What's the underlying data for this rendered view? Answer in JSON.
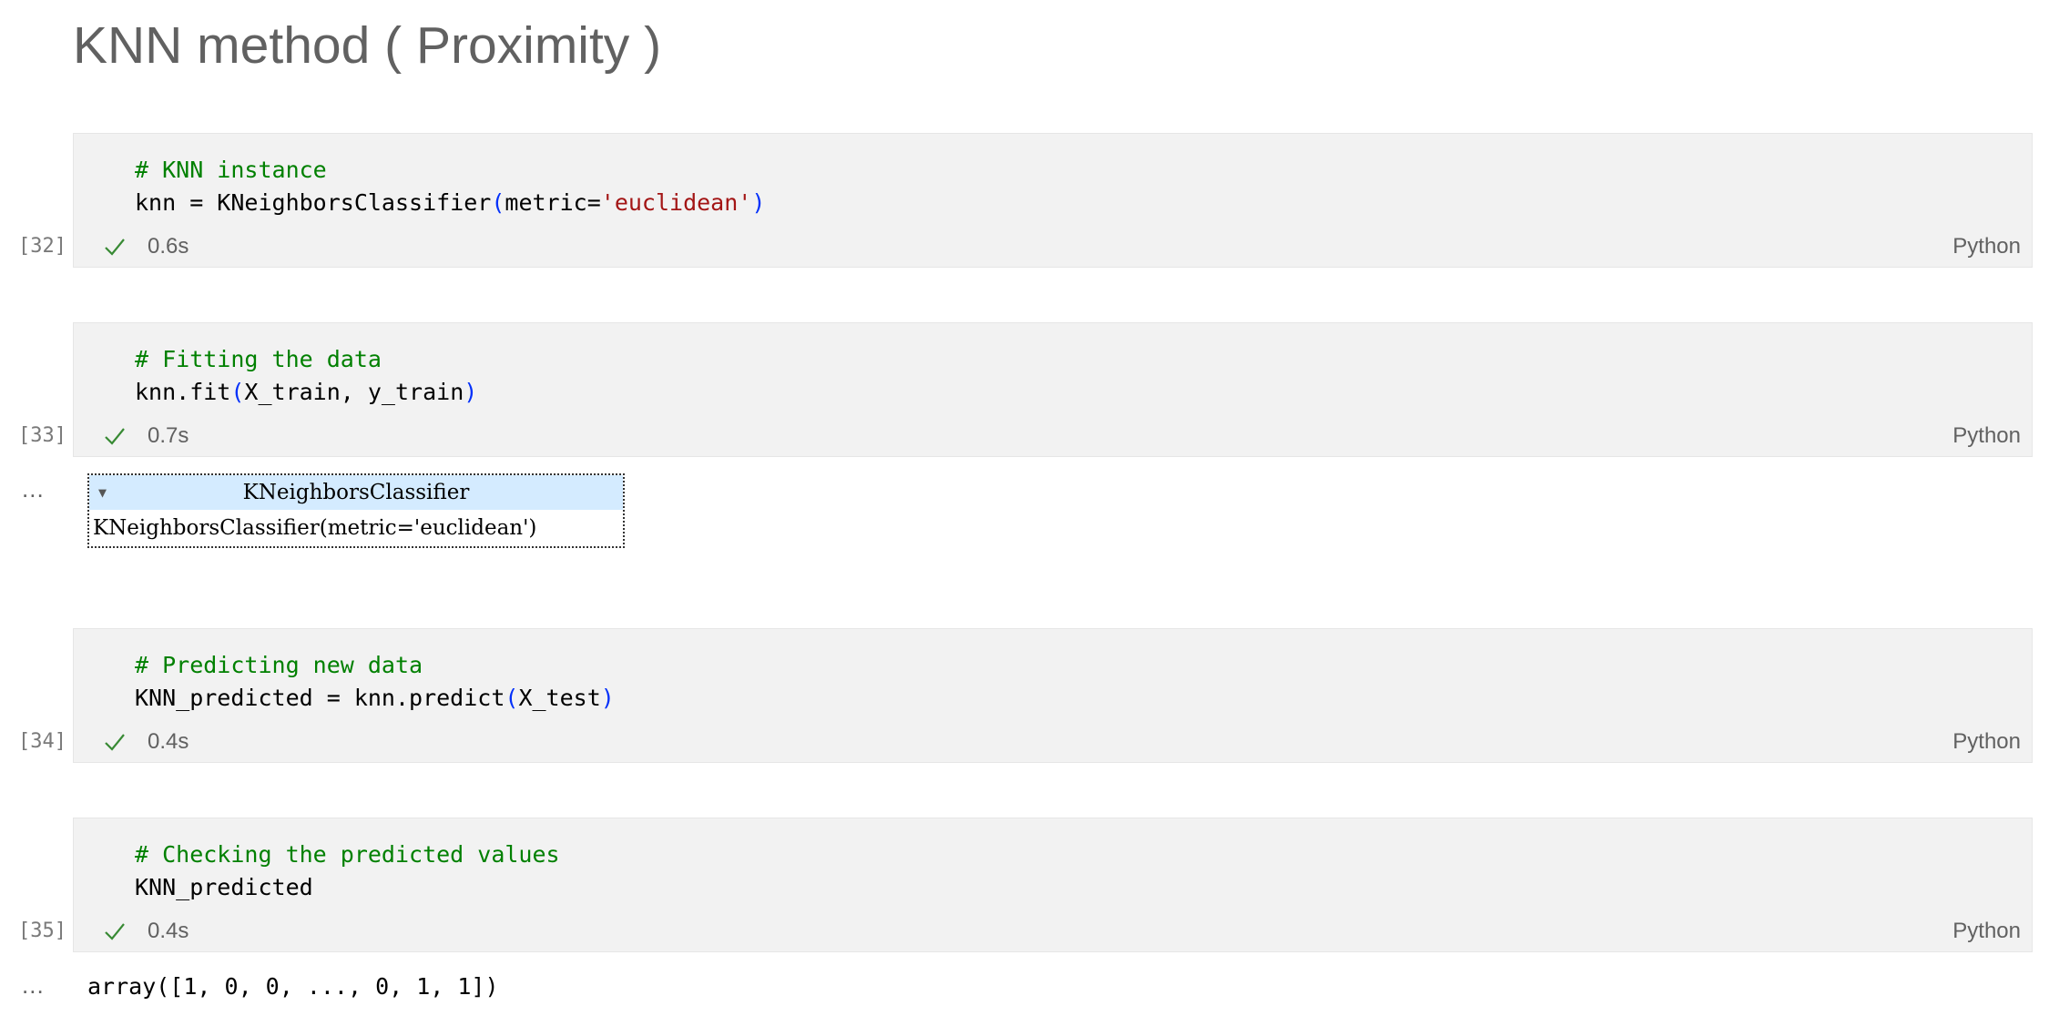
{
  "heading": "KNN method ( Proximity )",
  "cells": [
    {
      "execution_count": "[32]",
      "code": {
        "comment": "# KNN instance",
        "line2": {
          "prefix": "knn = KNeighborsClassifier",
          "open_paren": "(",
          "arg_name": "metric=",
          "arg_string": "'euclidean'",
          "close_paren": ")"
        }
      },
      "status": "0.6s",
      "language": "Python"
    },
    {
      "execution_count": "[33]",
      "code": {
        "comment": "# Fitting the data",
        "line2": {
          "prefix": "knn.fit",
          "open_paren": "(",
          "args": "X_train, y_train",
          "close_paren": ")"
        }
      },
      "status": "0.7s",
      "language": "Python",
      "output": {
        "ellipsis": "...",
        "estimator_title": "KNeighborsClassifier",
        "estimator_repr": "KNeighborsClassifier(metric='euclidean')",
        "toggle_icon": "triangle-down-icon"
      }
    },
    {
      "execution_count": "[34]",
      "code": {
        "comment": "# Predicting new data",
        "line2": {
          "prefix": "KNN_predicted = knn.predict",
          "open_paren": "(",
          "args": "X_test",
          "close_paren": ")"
        }
      },
      "status": "0.4s",
      "language": "Python"
    },
    {
      "execution_count": "[35]",
      "code": {
        "comment": "# Checking the predicted values",
        "line2": {
          "prefix": "KNN_predicted"
        }
      },
      "status": "0.4s",
      "language": "Python",
      "output": {
        "ellipsis": "...",
        "text": "array([1, 0, 0, ..., 0, 1, 1])"
      }
    }
  ],
  "colors": {
    "comment": "#008000",
    "string": "#a31515",
    "paren": "#0431fa",
    "check": "#388a34",
    "cell_background": "#f2f2f2",
    "estimator_header": "#d4ebff"
  },
  "icons": {
    "status": "check-icon",
    "more_output": "ellipsis-icon"
  }
}
